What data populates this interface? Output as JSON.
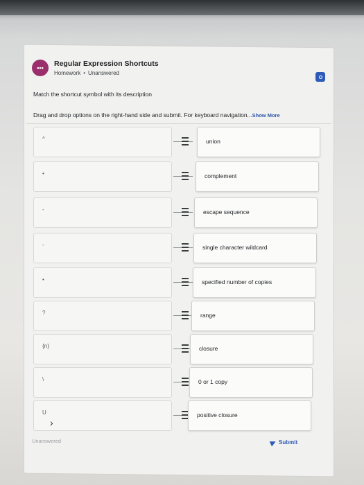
{
  "header": {
    "icon_text": "•••",
    "title": "Regular Expression Shortcuts",
    "assignment_type": "Homework",
    "status": "Unanswered"
  },
  "question": {
    "prompt": "Match the shortcut symbol with its description",
    "instructions": "Drag and drop options on the right-hand side and submit. For keyboard navigation...",
    "show_more": "Show More"
  },
  "rows": [
    {
      "symbol": "^",
      "description": "union"
    },
    {
      "symbol": "•",
      "description": "complement"
    },
    {
      "symbol": "-",
      "description": "escape sequence"
    },
    {
      "symbol": "-",
      "description": "single character wildcard"
    },
    {
      "symbol": "•",
      "description": "specified number of copies"
    },
    {
      "symbol": "?",
      "description": "range"
    },
    {
      "symbol": "{n}",
      "description": "closure"
    },
    {
      "symbol": "\\",
      "description": "0 or 1 copy"
    },
    {
      "symbol": "U",
      "description": "positive closure"
    }
  ],
  "footer": {
    "status": "Unanswered",
    "submit_label": "Submit"
  },
  "colors": {
    "brand_accent": "#9a2f6c",
    "link_blue": "#2f5bb8"
  }
}
